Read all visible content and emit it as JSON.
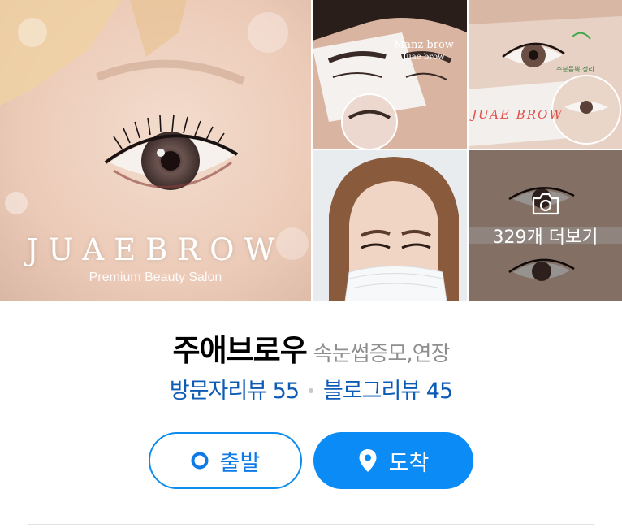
{
  "gallery": {
    "main": {
      "brand": "JUAEBROW",
      "subtitle": "Premium Beauty Salon"
    },
    "top_left": {
      "watermark": "Manz brow",
      "watermark_sub": "Juae brow"
    },
    "top_right": {
      "watermark": "JUAE BROW",
      "note": "수분듬뿍 정리"
    },
    "more": {
      "label": "329개 더보기",
      "icon": "camera-icon"
    }
  },
  "place": {
    "name": "주애브로우",
    "category": "속눈썹증모,연장"
  },
  "reviews": {
    "visitor": "방문자리뷰 55",
    "blog": "블로그리뷰 45"
  },
  "actions": {
    "depart": {
      "label": "출발",
      "icon": "origin-dot-icon"
    },
    "arrive": {
      "label": "도착",
      "icon": "location-pin-icon"
    }
  },
  "colors": {
    "accent": "#0b8bf5",
    "link": "#0d5bb5",
    "category": "#8e8e8e"
  }
}
